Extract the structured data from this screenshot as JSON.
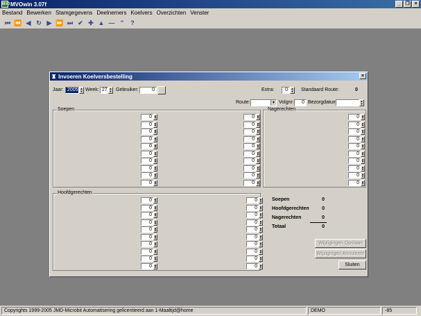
{
  "app": {
    "title": "MVOwin 3.07f"
  },
  "menu": [
    "Bestand",
    "Bewerken",
    "Stamgegevens",
    "Deelnemers",
    "Koelvers",
    "Overzichten",
    "Venster"
  ],
  "toolbar": [
    "⏮",
    "⏪",
    "◀",
    "↻",
    "▶",
    "⏩",
    "⏭",
    "✔",
    "✚",
    "▲",
    "—",
    "\"",
    "?"
  ],
  "dialog": {
    "title": "Invoeren Koelversbestelling",
    "jaar_label": "Jaar:",
    "jaar": "2005",
    "week_label": "Week:",
    "week": "27",
    "gebruiker_label": "Gebruiker:",
    "gebruiker": "0",
    "extra_label": "Extra:",
    "extra": "0",
    "standaard_route_label": "Standaard Route:",
    "standaard_route": "0",
    "route_label": "Route:",
    "route": "",
    "volgnr_label": "Volgnr:",
    "volgnr": "0",
    "bezorgdatum_label": "Bezorgdatum:",
    "bezorgdatum": "",
    "soepen_group": "Soepen",
    "nagerechten_group": "Nagerechten",
    "hoofdgerechten_group": "Hoofdgerechten",
    "qty": "0",
    "summary": {
      "soepen_label": "Soepen",
      "soepen": "0",
      "hoofdgerechten_label": "Hoofdgerechten",
      "hoofdgerechten": "0",
      "nagerechten_label": "Nagerechten",
      "nagerechten": "0",
      "totaal_label": "Totaal",
      "totaal": "0"
    },
    "btn_opslaan": "Wijzigingen Opslaan",
    "btn_annuleren": "Wijzigingen Annuleren",
    "btn_sluiten": "Sluiten"
  },
  "status": {
    "copyright": "Copyrights 1999-2005 JMD-Microbit Automatisering gelicentieerd aan 1-Maaltijd@home",
    "mode": "DEMO",
    "code": "-85"
  }
}
